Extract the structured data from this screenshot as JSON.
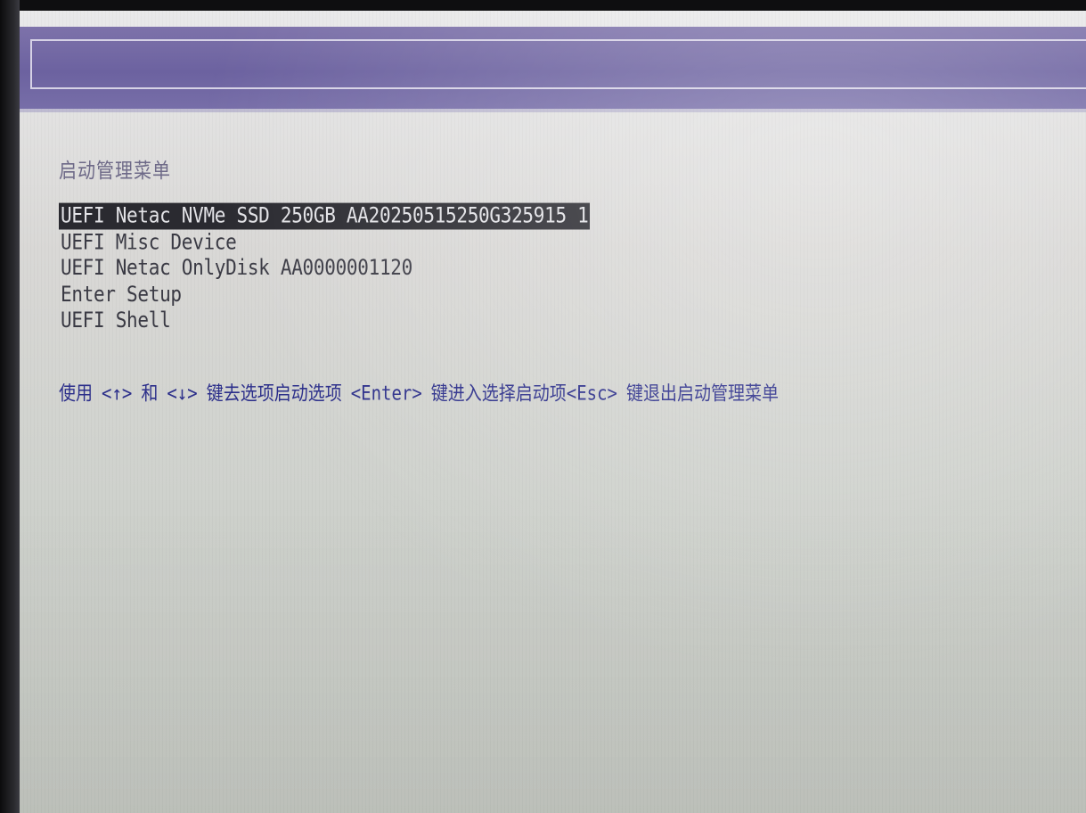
{
  "menu": {
    "title": "启动管理菜单",
    "items": [
      {
        "label": "UEFI Netac NVMe SSD 250GB AA20250515250G325915 1",
        "selected": true
      },
      {
        "label": "UEFI Misc Device",
        "selected": false
      },
      {
        "label": "UEFI Netac OnlyDisk AA0000001120",
        "selected": false
      },
      {
        "label": "Enter Setup",
        "selected": false
      },
      {
        "label": "UEFI Shell",
        "selected": false
      }
    ]
  },
  "help": {
    "use": "使用",
    "up_key": "<↑>",
    "and": "和",
    "down_key": "<↓>",
    "select_text": "键去选项启动选项",
    "enter_key": "<Enter>",
    "enter_text": "键进入选择启动项",
    "esc_key": "<Esc>",
    "esc_text": "键退出启动管理菜单"
  },
  "colors": {
    "title_bar": "#6c62a0",
    "screen_bg": "#d9d8d6",
    "highlight_bg": "#2a2a30",
    "help_text": "#2b2e8a",
    "menu_text": "#3a3a44"
  }
}
